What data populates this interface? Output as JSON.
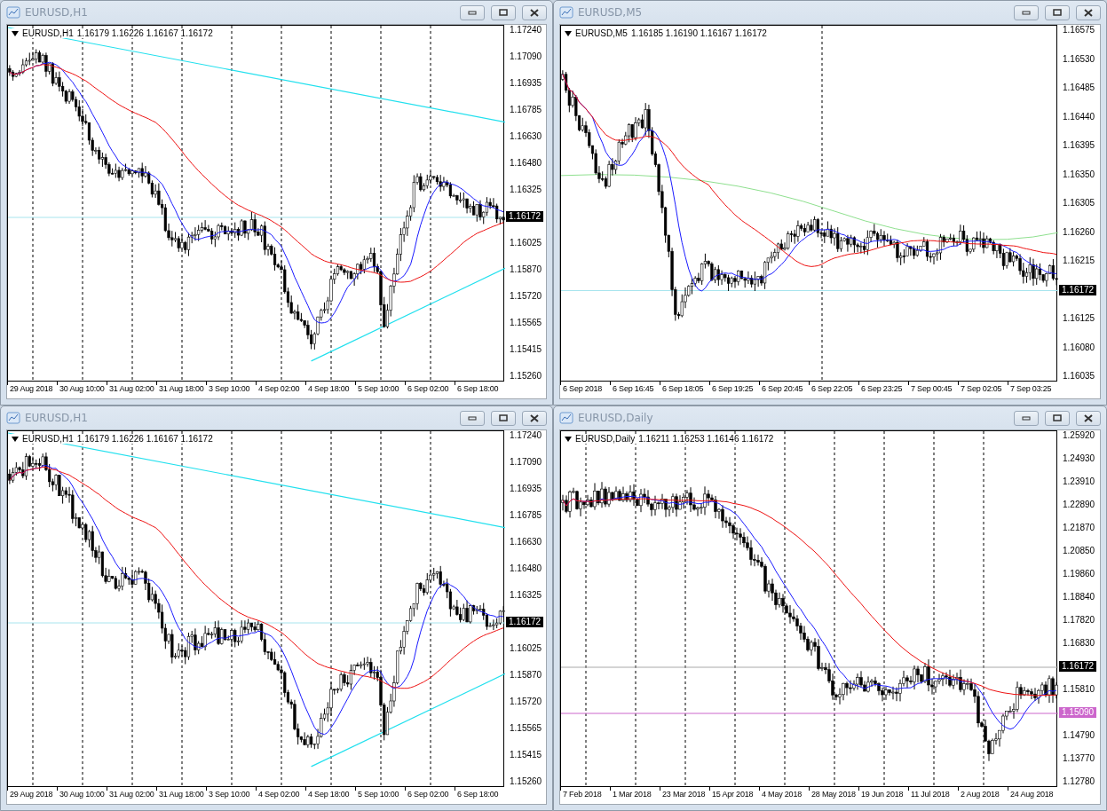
{
  "windows": [
    {
      "title": "EURUSD,H1",
      "header": {
        "symbol": "EURUSD,H1",
        "quote": "1.16179 1.16226 1.16167 1.16172"
      },
      "price_labels": [
        {
          "text": "1.17240",
          "kind": "tick"
        },
        {
          "text": "1.17090",
          "kind": "tick"
        },
        {
          "text": "1.16935",
          "kind": "tick"
        },
        {
          "text": "1.16785",
          "kind": "tick"
        },
        {
          "text": "1.16630",
          "kind": "tick"
        },
        {
          "text": "1.16480",
          "kind": "tick"
        },
        {
          "text": "1.16325",
          "kind": "tick"
        },
        {
          "text": "1.16172",
          "kind": "badge",
          "color": "#000000"
        },
        {
          "text": "1.16025",
          "kind": "tick"
        },
        {
          "text": "1.15870",
          "kind": "tick"
        },
        {
          "text": "1.15720",
          "kind": "tick"
        },
        {
          "text": "1.15565",
          "kind": "tick"
        },
        {
          "text": "1.15415",
          "kind": "tick"
        },
        {
          "text": "1.15260",
          "kind": "tick"
        }
      ],
      "time_labels": [
        "29 Aug 2018",
        "30 Aug 10:00",
        "31 Aug 02:00",
        "31 Aug 18:00",
        "3 Sep 10:00",
        "4 Sep 02:00",
        "4 Sep 18:00",
        "5 Sep 10:00",
        "6 Sep 02:00",
        "6 Sep 18:00"
      ]
    },
    {
      "title": "EURUSD,M5",
      "header": {
        "symbol": "EURUSD,M5",
        "quote": "1.16185 1.16190 1.16167 1.16172"
      },
      "price_labels": [
        {
          "text": "1.16575",
          "kind": "tick"
        },
        {
          "text": "1.16530",
          "kind": "tick"
        },
        {
          "text": "1.16485",
          "kind": "tick"
        },
        {
          "text": "1.16440",
          "kind": "tick"
        },
        {
          "text": "1.16395",
          "kind": "tick"
        },
        {
          "text": "1.16350",
          "kind": "tick"
        },
        {
          "text": "1.16305",
          "kind": "tick"
        },
        {
          "text": "1.16260",
          "kind": "tick"
        },
        {
          "text": "1.16215",
          "kind": "tick"
        },
        {
          "text": "1.16172",
          "kind": "badge",
          "color": "#000000"
        },
        {
          "text": "1.16125",
          "kind": "tick"
        },
        {
          "text": "1.16080",
          "kind": "tick"
        },
        {
          "text": "1.16035",
          "kind": "tick"
        }
      ],
      "time_labels": [
        "6 Sep 2018",
        "6 Sep 16:45",
        "6 Sep 18:05",
        "6 Sep 19:25",
        "6 Sep 20:45",
        "6 Sep 22:05",
        "6 Sep 23:25",
        "7 Sep 00:45",
        "7 Sep 02:05",
        "7 Sep 03:25"
      ]
    },
    {
      "title": "EURUSD,H1",
      "header": {
        "symbol": "EURUSD,H1",
        "quote": "1.16179 1.16226 1.16167 1.16172"
      },
      "price_labels": [
        {
          "text": "1.17240",
          "kind": "tick"
        },
        {
          "text": "1.17090",
          "kind": "tick"
        },
        {
          "text": "1.16935",
          "kind": "tick"
        },
        {
          "text": "1.16785",
          "kind": "tick"
        },
        {
          "text": "1.16630",
          "kind": "tick"
        },
        {
          "text": "1.16480",
          "kind": "tick"
        },
        {
          "text": "1.16325",
          "kind": "tick"
        },
        {
          "text": "1.16172",
          "kind": "badge",
          "color": "#000000"
        },
        {
          "text": "1.16025",
          "kind": "tick"
        },
        {
          "text": "1.15870",
          "kind": "tick"
        },
        {
          "text": "1.15720",
          "kind": "tick"
        },
        {
          "text": "1.15565",
          "kind": "tick"
        },
        {
          "text": "1.15415",
          "kind": "tick"
        },
        {
          "text": "1.15260",
          "kind": "tick"
        }
      ],
      "time_labels": [
        "29 Aug 2018",
        "30 Aug 10:00",
        "31 Aug 02:00",
        "31 Aug 18:00",
        "3 Sep 10:00",
        "4 Sep 02:00",
        "4 Sep 18:00",
        "5 Sep 10:00",
        "6 Sep 02:00",
        "6 Sep 18:00"
      ]
    },
    {
      "title": "EURUSD,Daily",
      "header": {
        "symbol": "EURUSD,Daily",
        "quote": "1.16211 1.16253 1.16146 1.16172"
      },
      "price_labels": [
        {
          "text": "1.25920",
          "kind": "tick"
        },
        {
          "text": "1.24930",
          "kind": "tick"
        },
        {
          "text": "1.23910",
          "kind": "tick"
        },
        {
          "text": "1.22890",
          "kind": "tick"
        },
        {
          "text": "1.21870",
          "kind": "tick"
        },
        {
          "text": "1.20850",
          "kind": "tick"
        },
        {
          "text": "1.19860",
          "kind": "tick"
        },
        {
          "text": "1.18840",
          "kind": "tick"
        },
        {
          "text": "1.17820",
          "kind": "tick"
        },
        {
          "text": "1.16830",
          "kind": "tick"
        },
        {
          "text": "1.16172",
          "kind": "badge",
          "color": "#000000"
        },
        {
          "text": "1.15810",
          "kind": "tick"
        },
        {
          "text": "1.15090",
          "kind": "badge",
          "color": "#cc66cc"
        },
        {
          "text": "1.14790",
          "kind": "tick"
        },
        {
          "text": "1.13770",
          "kind": "tick"
        },
        {
          "text": "1.12780",
          "kind": "tick"
        }
      ],
      "time_labels": [
        "7 Feb 2018",
        "1 Mar 2018",
        "23 Mar 2018",
        "15 Apr 2018",
        "4 May 2018",
        "28 May 2018",
        "19 Jun 2018",
        "11 Jul 2018",
        "2 Aug 2018",
        "24 Aug 2018"
      ]
    }
  ]
}
